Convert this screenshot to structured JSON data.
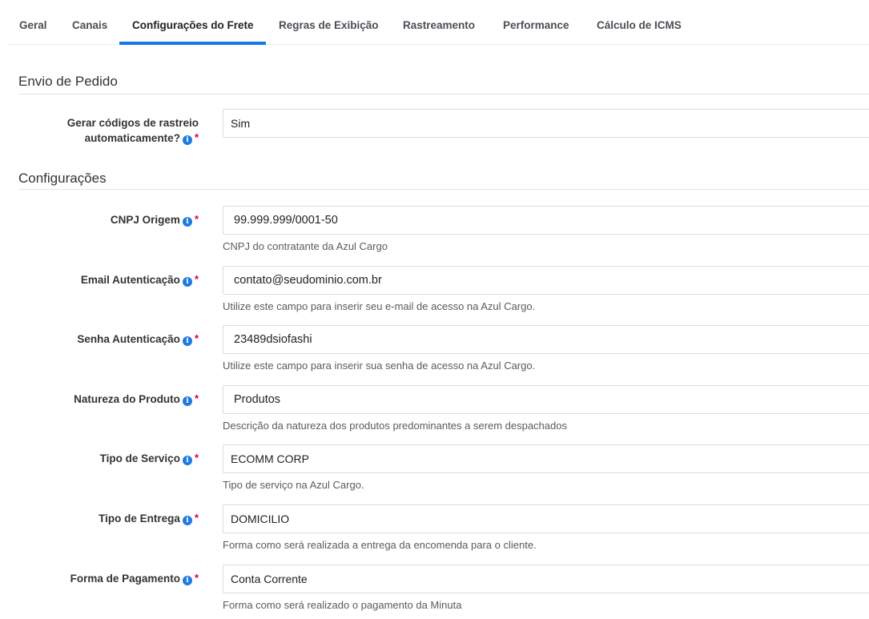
{
  "tabs": [
    {
      "label": "Geral",
      "active": false
    },
    {
      "label": "Canais",
      "active": false
    },
    {
      "label": "Configurações do Frete",
      "active": true
    },
    {
      "label": "Regras de Exibição",
      "active": false
    },
    {
      "label": "Rastreamento",
      "active": false
    },
    {
      "label": "Performance",
      "active": false
    },
    {
      "label": "Cálculo de ICMS",
      "active": false
    }
  ],
  "sections": {
    "envio": {
      "title": "Envio de Pedido"
    },
    "config": {
      "title": "Configurações"
    }
  },
  "fields": {
    "rastreio": {
      "label_line1": "Gerar códigos de rastreio",
      "label_line2": "automaticamente?",
      "value": "Sim"
    },
    "cnpj": {
      "label": "CNPJ Origem",
      "value": "99.999.999/0001-50",
      "hint": "CNPJ do contratante da Azul Cargo"
    },
    "email": {
      "label": "Email Autenticação",
      "value": "contato@seudominio.com.br",
      "hint": "Utilize este campo para inserir seu e-mail de acesso na Azul Cargo."
    },
    "senha": {
      "label": "Senha Autenticação",
      "value": "23489dsiofashi",
      "hint": "Utilize este campo para inserir sua senha de acesso na Azul Cargo."
    },
    "natureza": {
      "label": "Natureza do Produto",
      "value": "Produtos",
      "hint": "Descrição da natureza dos produtos predominantes a serem despachados"
    },
    "servico": {
      "label": "Tipo de Serviço",
      "value": "ECOMM CORP",
      "hint": "Tipo de serviço na Azul Cargo."
    },
    "entrega": {
      "label": "Tipo de Entrega",
      "value": "DOMICILIO",
      "hint": "Forma como será realizada a entrega da encomenda para o cliente."
    },
    "pagamento": {
      "label": "Forma de Pagamento",
      "value": "Conta Corrente",
      "hint": "Forma como será realizado o pagamento da Minuta"
    }
  },
  "icons": {
    "info": "info-icon",
    "required": "*"
  },
  "colors": {
    "accent": "#1877e5",
    "info": "#1e7ae0",
    "required": "#e0001b"
  }
}
